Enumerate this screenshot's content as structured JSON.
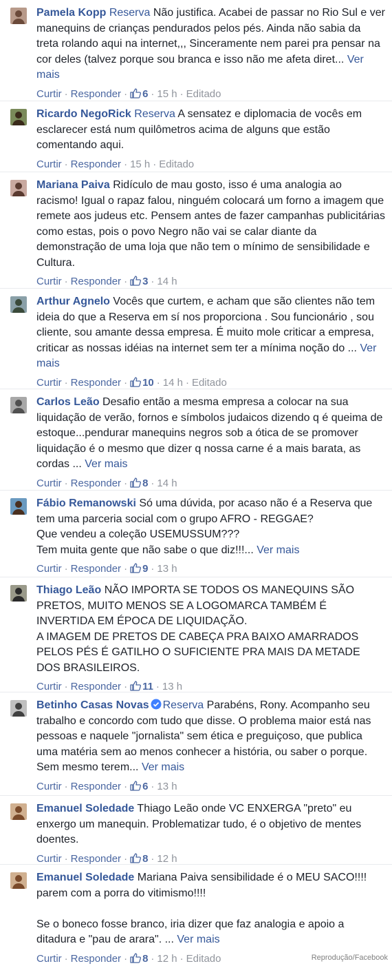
{
  "actions": {
    "like": "Curtir",
    "reply": "Responder",
    "more": "Ver mais",
    "sep": "·"
  },
  "credit": "Reprodução/Facebook",
  "colors": {
    "link": "#365899",
    "meta": "#90949c",
    "text": "#1d2129"
  },
  "comments": [
    {
      "author": "Pamela Kopp",
      "page": "Reserva",
      "text": "Não justifica. Acabei de passar no Rio Sul e ver manequins de crianças pendurados pelos pés. Ainda não sabia da treta rolando aqui na internet,,, Sinceramente nem parei pra pensar na cor deles (talvez porque sou branca e isso não me afeta diret...",
      "more": "Ver mais",
      "likes": "6",
      "time": "15 h",
      "edited": "Editado"
    },
    {
      "author": "Ricardo NegoRick",
      "page": "Reserva",
      "text": "A sensatez e diplomacia de vocês em esclarecer está num quilômetros acima de alguns que estão comentando aqui.",
      "likes": "",
      "time": "15 h",
      "edited": "Editado"
    },
    {
      "author": "Mariana Paiva",
      "text": "Ridículo de mau gosto, isso é uma analogia ao racismo! Igual o rapaz falou, ninguém colocará um forno a imagem que remete aos judeus etc. Pensem antes de fazer campanhas publicitárias como estas, pois o povo Negro não vai se calar diante da demonstração de uma loja que não tem o mínimo de sensibilidade e Cultura.",
      "likes": "3",
      "time": "14 h"
    },
    {
      "author": "Arthur Agnelo",
      "text": "Vocês que curtem, e acham que são clientes não tem ideia do que a Reserva em sí nos proporciona . Sou funcionário , sou cliente, sou amante dessa empresa. É muito mole criticar a empresa, criticar as nossas idéias na internet sem ter a mínima noção do ...",
      "more": "Ver mais",
      "likes": "10",
      "time": "14 h",
      "edited": "Editado"
    },
    {
      "author": "Carlos Leão",
      "text": "Desafio então a mesma empresa a colocar na sua liquidação de verão, fornos e símbolos judaicos dizendo q é queima de estoque...pendurar manequins negros sob a ótica de se promover liquidação é o mesmo que dizer q nossa carne é a mais barata, as cordas ...",
      "more": "Ver mais",
      "likes": "8",
      "time": "14 h"
    },
    {
      "author": "Fábio Remanowski",
      "text": "Só uma dúvida, por acaso não é a Reserva que tem uma parceria social com o grupo AFRO - REGGAE?\nQue vendeu a coleção USEMUSSUM???\nTem muita gente que não sabe o que diz!!!...",
      "more": "Ver mais",
      "likes": "9",
      "time": "13 h"
    },
    {
      "author": "Thiago Leão",
      "text": "NÃO IMPORTA SE TODOS OS MANEQUINS SÃO PRETOS, MUITO MENOS SE A LOGOMARCA TAMBÉM É INVERTIDA EM ÉPOCA DE LIQUIDAÇÃO.\nA IMAGEM DE PRETOS DE CABEÇA PRA BAIXO AMARRADOS PELOS PÉS É GATILHO O SUFICIENTE PRA MAIS DA METADE DOS BRASILEIROS.",
      "likes": "11",
      "time": "13 h"
    },
    {
      "author": "Betinho Casas Novas",
      "verified": true,
      "page": "Reserva",
      "text": "Parabéns, Rony. Acompanho seu trabalho e concordo com tudo que disse. O problema maior está nas pessoas e naquele \"jornalista\" sem ética e preguiçoso, que publica uma matéria sem ao menos conhecer a história, ou saber o porque. Sem mesmo terem...",
      "more": "Ver mais",
      "likes": "6",
      "time": "13 h"
    },
    {
      "author": "Emanuel Soledade",
      "text": "Thiago Leão onde VC ENXERGA \"preto\" eu enxergo um manequin. Problematizar tudo, é o objetivo de mentes doentes.",
      "likes": "8",
      "time": "12 h"
    },
    {
      "author": "Emanuel Soledade",
      "text": "Mariana Paiva sensibilidade é o MEU SACO!!!! parem com a porra do vitimismo!!!!\n\nSe o boneco fosse branco, iria dizer que faz analogia e apoio a ditadura e \"pau de arara\". ...",
      "more": "Ver mais",
      "likes": "8",
      "time": "12 h",
      "edited": "Editado"
    }
  ]
}
